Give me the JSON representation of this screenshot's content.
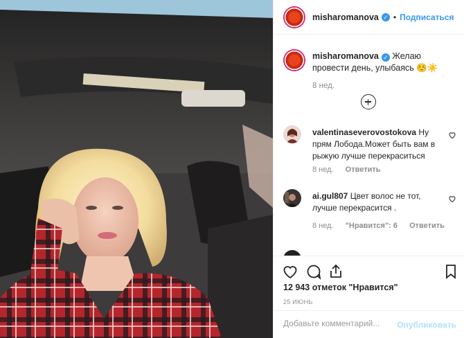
{
  "post": {
    "username": "misharomanova",
    "follow_label": "Подписаться",
    "separator": "•",
    "photo_description_icon": "photo-icon"
  },
  "caption": {
    "username": "misharomanova",
    "text": "Желаю провести день, улыбаясь ☺️☀️",
    "time": "8 нед."
  },
  "comments": [
    {
      "username": "valentinaseverovostokova",
      "text": "Ну прям Лобода.Может быть вам в рыжую лучше перекраситься",
      "time": "8 нед.",
      "reply": "Ответить",
      "likes": ""
    },
    {
      "username": "ai.gul807",
      "text": "Цвет волос не тот, лучше перекрасится .",
      "time": "8 нед.",
      "likes": "\"Нравится\": 6",
      "reply": "Ответить"
    }
  ],
  "stats": {
    "likes": "12 943 отметок \"Нравится\"",
    "date": "25 ИЮНЬ"
  },
  "add_comment": {
    "placeholder": "Добавьте комментарий...",
    "publish": "Опубликовать"
  },
  "colors": {
    "accent": "#3897f0",
    "muted": "#8e8e8e",
    "publish_disabled": "#b2dffc"
  }
}
